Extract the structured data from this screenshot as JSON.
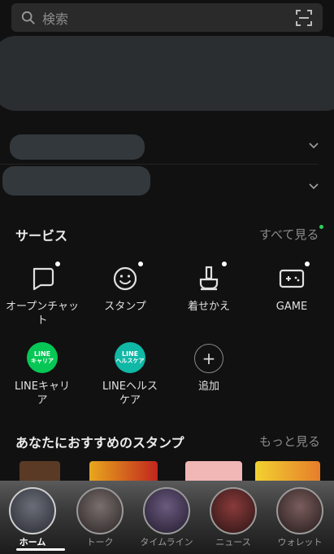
{
  "search": {
    "placeholder": "検索",
    "icon": "search-icon",
    "scan_icon": "qr-scan-icon"
  },
  "services": {
    "title": "サービス",
    "see_all": "すべて見る",
    "items": [
      {
        "label": "オープンチャット",
        "icon": "open-chat-icon",
        "badge": true
      },
      {
        "label": "スタンプ",
        "icon": "smiley-icon",
        "badge": true
      },
      {
        "label": "着せかえ",
        "icon": "brush-icon",
        "badge": true
      },
      {
        "label": "GAME",
        "icon": "game-controller-icon",
        "badge": true
      },
      {
        "label": "LINEキャリア",
        "icon": "line-career-icon",
        "badge_text_1": "LINE",
        "badge_text_2": "キャリア",
        "color": "#06c755"
      },
      {
        "label": "LINEヘルスケア",
        "icon": "line-healthcare-icon",
        "badge_text_1": "LINE",
        "badge_text_2": "ヘルスケア",
        "color": "#10b8a6"
      },
      {
        "label": "追加",
        "icon": "add-icon"
      }
    ]
  },
  "stickers": {
    "title": "あなたにおすすめのスタンプ",
    "more": "もっと見る"
  },
  "nav": {
    "items": [
      {
        "label": "ホーム",
        "active": true
      },
      {
        "label": "トーク",
        "active": false
      },
      {
        "label": "タイムライン",
        "active": false
      },
      {
        "label": "ニュース",
        "active": false
      },
      {
        "label": "ウォレット",
        "active": false
      }
    ]
  },
  "colors": {
    "accent_green": "#2ed05a",
    "background": "#111111"
  }
}
